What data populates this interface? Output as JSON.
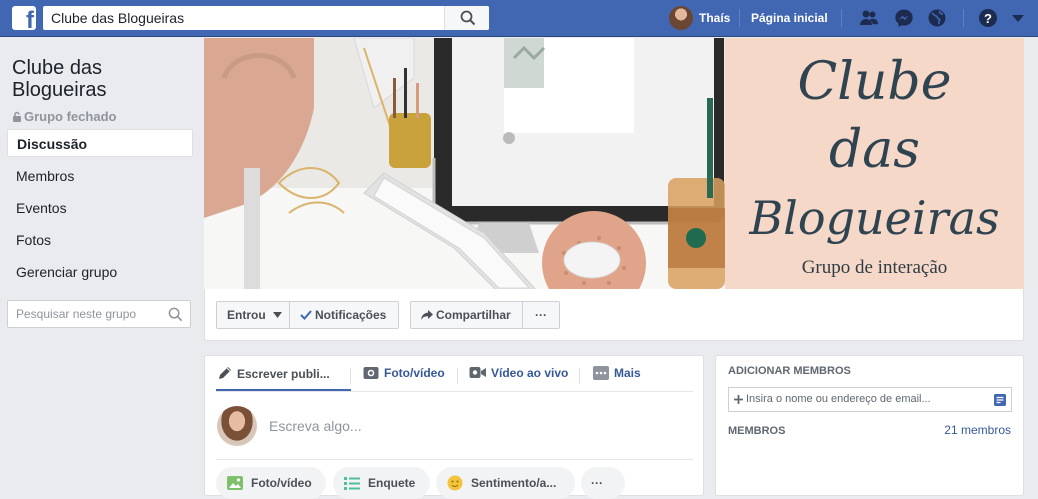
{
  "topbar": {
    "search_value": "Clube das Blogueiras",
    "user_name": "Thaís",
    "home_label": "Página inicial",
    "icons": [
      "facebook-logo",
      "search-icon",
      "friends-icon",
      "messenger-icon",
      "globe-icon",
      "help-icon",
      "chevron-down-icon"
    ],
    "bar_color": "#4267b2"
  },
  "sidebar": {
    "group_name": "Clube das Blogueiras",
    "group_privacy": "Grupo fechado",
    "items": [
      {
        "label": "Discussão",
        "active": true
      },
      {
        "label": "Membros"
      },
      {
        "label": "Eventos"
      },
      {
        "label": "Fotos"
      },
      {
        "label": "Gerenciar grupo"
      }
    ],
    "search_placeholder": "Pesquisar neste grupo"
  },
  "cover": {
    "title_line1": "Clube",
    "title_line2": "das",
    "title_line3": "Blogueiras",
    "subtitle": "Grupo de interação",
    "title_bg": "#f6d8c8"
  },
  "actions": {
    "joined": "Entrou",
    "notifications": "Notificações",
    "share": "Compartilhar",
    "more": "···"
  },
  "composer": {
    "tabs": [
      {
        "label": "Escrever publi..."
      },
      {
        "label": "Foto/vídeo"
      },
      {
        "label": "Vídeo ao vivo"
      },
      {
        "label": "Mais"
      }
    ],
    "placeholder": "Escreva algo...",
    "pills": [
      {
        "label": "Foto/vídeo"
      },
      {
        "label": "Enquete"
      },
      {
        "label": "Sentimento/a..."
      },
      {
        "label": "···"
      }
    ]
  },
  "members_panel": {
    "add_heading": "ADICIONAR MEMBROS",
    "add_placeholder": "Insira o nome ou endereço de email...",
    "members_heading": "MEMBROS",
    "members_count": "21 membros"
  }
}
